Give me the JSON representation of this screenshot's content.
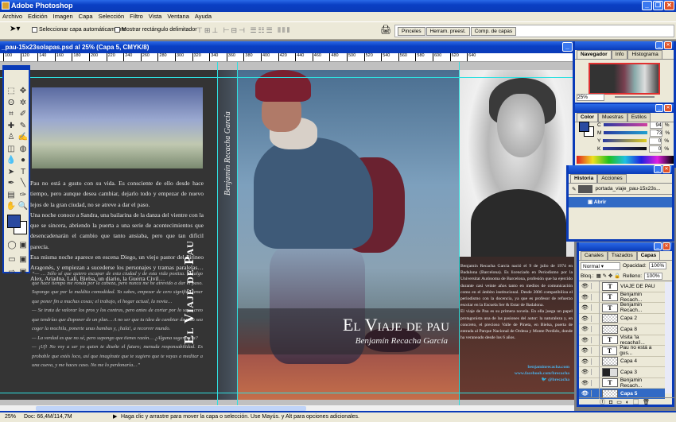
{
  "app": {
    "title": "Adobe Photoshop"
  },
  "menu": [
    "Archivo",
    "Edición",
    "Imagen",
    "Capa",
    "Selección",
    "Filtro",
    "Vista",
    "Ventana",
    "Ayuda"
  ],
  "options": {
    "auto_select": "Seleccionar capa automáticamente",
    "show_bounds": "Mostrar rectángulo delimitador",
    "well_tabs": [
      "Pinceles",
      "Herram. preest.",
      "Comp. de capas"
    ]
  },
  "document": {
    "title": "_pau-15x23solapas.psd al 25% (Capa 5, CMYK/8)",
    "ruler": [
      "100",
      "120",
      "140",
      "160",
      "180",
      "200",
      "220",
      "240",
      "260",
      "280",
      "300",
      "320",
      "340",
      "360",
      "380",
      "400",
      "420",
      "440",
      "460",
      "480",
      "500",
      "520",
      "540",
      "560",
      "580",
      "600",
      "620",
      "640"
    ]
  },
  "book": {
    "back_text": [
      "Pau no está a gusto con su vida. Es consciente de ello desde hace tiempo, pero aunque desea cambiar, dejarlo todo y empezar de nuevo lejos de la gran ciudad, no se atreve a dar el paso.",
      "Una noche conoce a Sandra, una bailarina de la danza del vientre con la que se sincera, abriendo la puerta a una serie de acontecimientos que desencadenarán el cambio que tanto ansiaba, pero que tan difícil parecía.",
      "Esa misma noche aparece en escena Diego, un viejo pastor del Pirineo Aragonés, y empiezan a sucederse los personajes y tramas paralelas… Alex, Ariadna, Lali, Bielsa, un diario, la Guerra Civil…"
    ],
    "back_quote": [
      "“— … Sólo sé que quiero escapar de esta ciudad y de esta vida postiza. Es algo que hace tiempo me ronda por la cabeza, pero nunca me he atrevido a dar el paso. Supongo que por la maldita comodidad. Ya sabes, empezar de cero significa tener que poner fin a muchas cosas; el trabajo, el hogar actual, la novia…",
      "— Se trata de valorar los pros y los contras, pero antes de cortar por lo sano creo que tendrías que disponer de un plan… A no ser que tu idea de cambiar de vida sea coger la mochila, ponerte unas bambas y, ¡hala!, a recorrer mundo.",
      "— La verdad es que no sé, pero supongo que tienes razón… ¿Alguna sugerencia?",
      "— ¡Uf! No voy a ser yo quien te diseñe el futuro; menuda responsabilidad. Es probable que estés loco, así que imagínate que te sugiero que te vayas a meditar a una cueva, y me haces caso. No me lo perdonaría…”"
    ],
    "spine_title": "El Viaje de Pau",
    "spine_author": "Benjamín Recacha García",
    "cover_title": "El Viaje de pau",
    "cover_author": "Benjamín Recacha García",
    "flap_text": [
      "Benjamín Recacha García nació el 9 de julio de 1974 en Badalona (Barcelona). Es licenciado en Periodismo por la Universitat Autònoma de Barcelona, profesión que ha ejercido durante casi veinte años tanto en medios de comunicación como en el ámbito institucional. Desde 2006 compatibiliza el periodismo con la docencia, ya que es profesor de refuerzo escolar en la Escuela Ser & Estar de Badalona.",
      "El viaje de Pau es su primera novela. En ella juega un papel protagonista una de las pasiones del autor: la naturaleza y, en concreto, el precioso Valle de Pineta, en Bielsa, puerta de entrada al Parque Nacional de Ordesa y Monte Perdido, donde ha veraneado desde los 6 años."
    ],
    "links": [
      "benjaminrecacha.com",
      "www.facebook.com/brecacha",
      "@brecacha"
    ]
  },
  "navigator": {
    "tabs": [
      "Navegador",
      "Info",
      "Histograma"
    ],
    "zoom": "25%"
  },
  "color": {
    "tabs": [
      "Color",
      "Muestras",
      "Estilos"
    ],
    "channels": [
      {
        "label": "C",
        "value": "94"
      },
      {
        "label": "M",
        "value": "73"
      },
      {
        "label": "Y",
        "value": "0"
      },
      {
        "label": "K",
        "value": "0"
      }
    ],
    "unit": "%",
    "foreground": "#2a4aa0",
    "background": "#ffffff"
  },
  "history": {
    "tabs": [
      "Historia",
      "Acciones"
    ],
    "snapshot": "portada_viaje_pau-15x23s...",
    "items": [
      "Abrir"
    ]
  },
  "layers": {
    "tabs": [
      "Canales",
      "Trazados",
      "Capas"
    ],
    "blend": "Normal",
    "opacity_label": "Opacidad:",
    "opacity": "100%",
    "lock_label": "Bloq.:",
    "fill_label": "Relleno:",
    "fill": "100%",
    "items": [
      {
        "name": "VIAJE DE PAU",
        "type": "text"
      },
      {
        "name": "Benjamin Recach...",
        "type": "text"
      },
      {
        "name": "Benjamin Recach...",
        "type": "text"
      },
      {
        "name": "Capa 2",
        "type": "checker"
      },
      {
        "name": "Capa 8",
        "type": "checker"
      },
      {
        "name": "Visita 'la recacha'i...",
        "type": "text"
      },
      {
        "name": "Pau no está a gus...",
        "type": "text"
      },
      {
        "name": "Capa 4",
        "type": "checker"
      },
      {
        "name": "Capa 3",
        "type": "dark"
      },
      {
        "name": "Benjamin Recach...",
        "type": "text"
      },
      {
        "name": "Capa 5",
        "type": "checker",
        "selected": true
      }
    ]
  },
  "status": {
    "zoom": "25%",
    "doc": "Doc: 66,4M/114,7M",
    "hint": "Haga clic y arrastre para mover la capa o selección. Use Mayús. y Alt para opciones adicionales."
  }
}
